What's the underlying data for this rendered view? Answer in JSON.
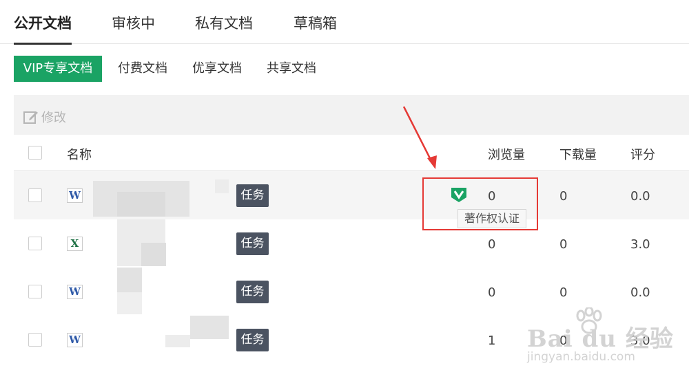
{
  "main_tabs": [
    "公开文档",
    "审核中",
    "私有文档",
    "草稿箱"
  ],
  "sub_tabs": [
    "VIP专享文档",
    "付费文档",
    "优享文档",
    "共享文档"
  ],
  "toolbar": {
    "edit_label": "修改"
  },
  "table": {
    "headers": {
      "name": "名称",
      "views": "浏览量",
      "downloads": "下载量",
      "rating": "评分"
    },
    "rows": [
      {
        "type": "word",
        "icon_letter": "W",
        "badge": "任务",
        "views": "0",
        "downloads": "0",
        "rating": "0.0",
        "copyright": true
      },
      {
        "type": "excel",
        "icon_letter": "X",
        "badge": "任务",
        "views": "0",
        "downloads": "0",
        "rating": "3.0",
        "copyright": false
      },
      {
        "type": "word",
        "icon_letter": "W",
        "badge": "任务",
        "views": "0",
        "downloads": "0",
        "rating": "0.0",
        "copyright": false
      },
      {
        "type": "word",
        "icon_letter": "W",
        "badge": "任务",
        "views": "1",
        "downloads": "0",
        "rating": "3.0",
        "copyright": false
      }
    ]
  },
  "tooltip": {
    "copyright_label": "著作权认证"
  },
  "watermark": {
    "main": "Bai du 经验",
    "sub": "jingyan.baidu.com"
  },
  "colors": {
    "accent": "#1aa364",
    "badge": "#4b5361",
    "highlight_box": "#e53935"
  }
}
